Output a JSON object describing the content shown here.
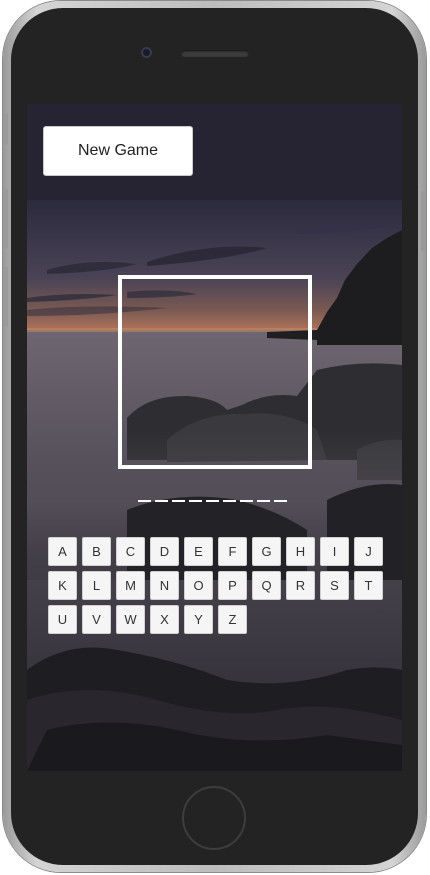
{
  "game": {
    "new_game_label": "New Game",
    "word_length": 9,
    "letters": [
      [
        "A",
        "B",
        "C",
        "D",
        "E",
        "F",
        "G",
        "H",
        "I",
        "J"
      ],
      [
        "K",
        "L",
        "M",
        "N",
        "O",
        "P",
        "Q",
        "R",
        "S",
        "T"
      ],
      [
        "U",
        "V",
        "W",
        "X",
        "Y",
        "Z"
      ]
    ]
  },
  "colors": {
    "background": "#262433",
    "key": "#f5f5f5",
    "frame": "#ffffff"
  }
}
